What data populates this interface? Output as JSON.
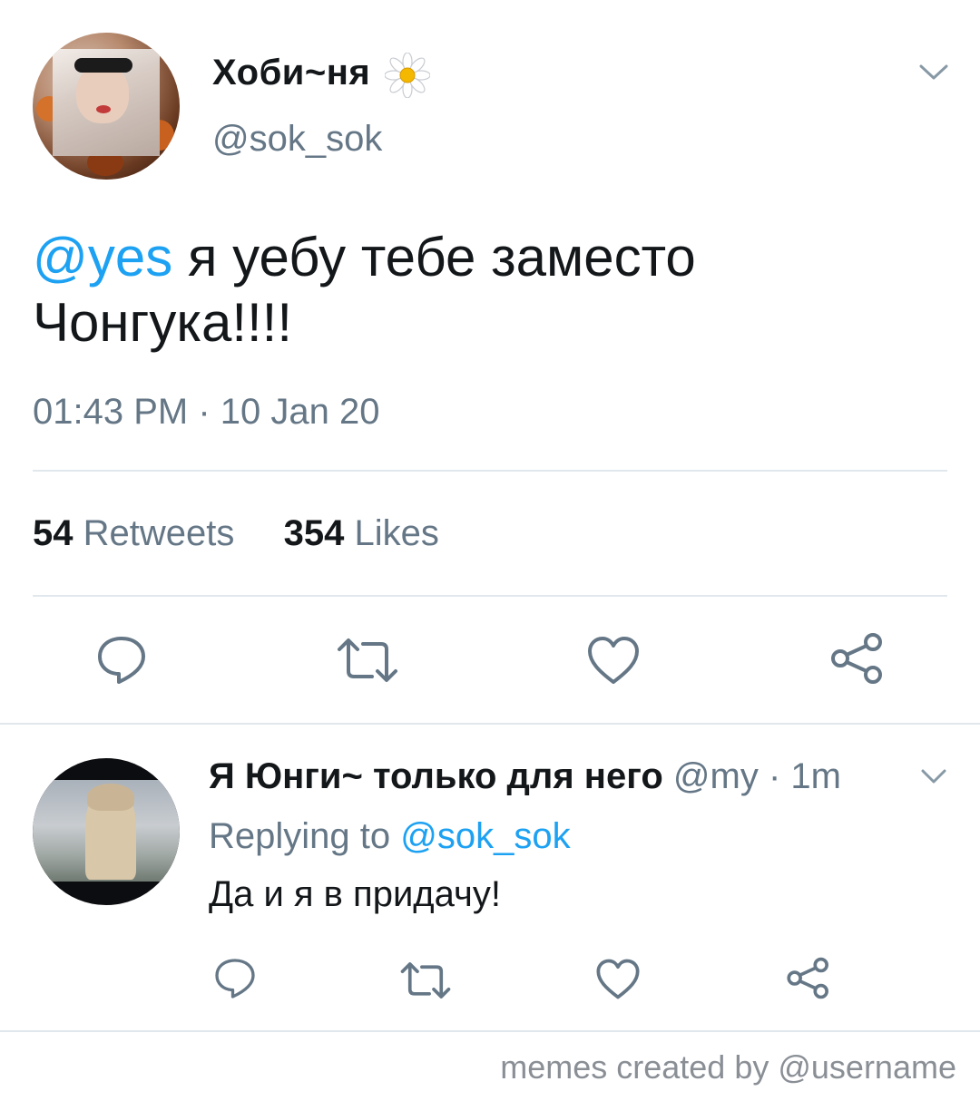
{
  "tweet": {
    "display_name": "Хоби~ня",
    "handle": "@sok_sok",
    "mention": "@yes",
    "text": " я уебу тебе заместо Чонгука!!!!",
    "timestamp": "01:43 PM · 10 Jan 20",
    "retweets_count": "54",
    "retweets_label": "Retweets",
    "likes_count": "354",
    "likes_label": "Likes"
  },
  "reply": {
    "display_name": "Я Юнги~ только для него",
    "handle": "@my",
    "separator": " · ",
    "time": "1m",
    "replying_label": "Replying to ",
    "replying_to": "@sok_sok",
    "text": "Да и я в придачу!"
  },
  "watermark": "memes created by @username",
  "icons": {
    "flower": "daisy-icon",
    "menu": "chevron-down-icon",
    "reply": "comment-icon",
    "retweet": "retweet-icon",
    "like": "heart-icon",
    "share": "share-icon"
  },
  "colors": {
    "accent": "#1da1f2",
    "secondary_text": "#657786",
    "divider": "#e1e8ed"
  }
}
